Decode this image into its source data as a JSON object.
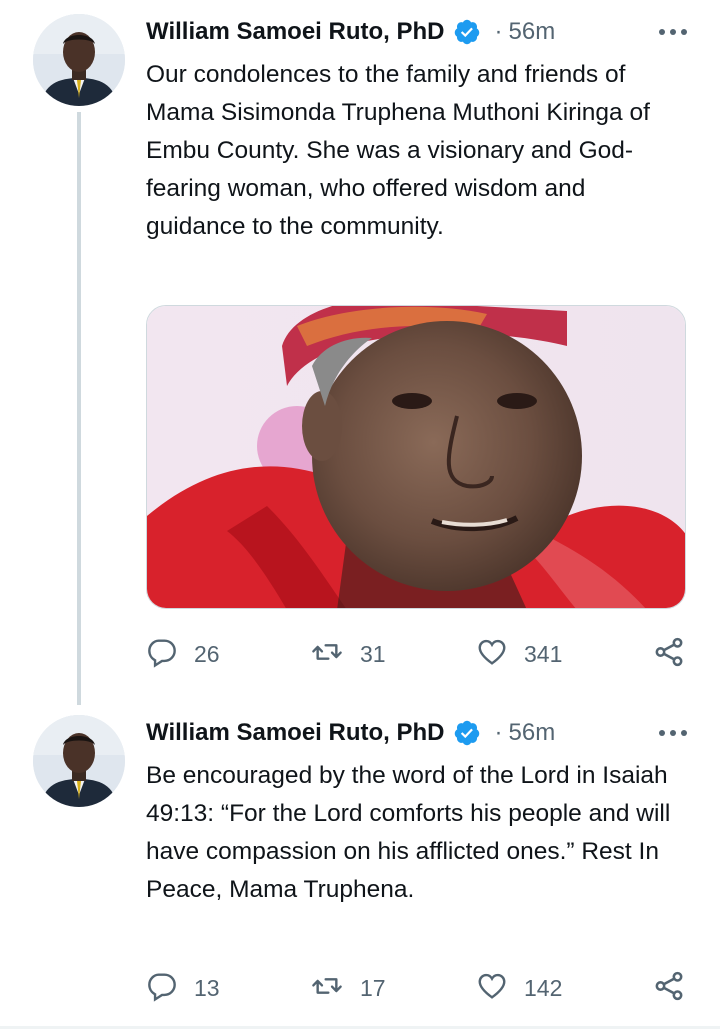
{
  "tweets": [
    {
      "author": {
        "name": "William Samoei Ruto, PhD",
        "verified": true
      },
      "separator": "·",
      "time": "56m",
      "text": "Our condolences to the family and friends of Mama Sisimonda Truphena Muthoni Kiringa of Embu County. She was a visionary and God-fearing woman, who offered wisdom and guidance to the community.",
      "has_media": true,
      "stats": {
        "replies": "26",
        "retweets": "31",
        "likes": "341"
      }
    },
    {
      "author": {
        "name": "William Samoei Ruto, PhD",
        "verified": true
      },
      "separator": "·",
      "time": "56m",
      "text": "Be encouraged by the word of the Lord in Isaiah 49:13: “For the Lord comforts his people and will have compassion on his afflicted ones.” Rest In Peace, Mama Truphena.",
      "has_media": false,
      "stats": {
        "replies": "13",
        "retweets": "17",
        "likes": "142"
      }
    }
  ],
  "icons": {
    "verified": "verified-badge-icon",
    "more": "more-options-icon",
    "reply": "reply-icon",
    "retweet": "retweet-icon",
    "like": "like-icon",
    "share": "share-icon"
  },
  "colors": {
    "text": "#0f1419",
    "secondary": "#536471",
    "verified": "#1d9bf0",
    "thread_line": "#cfd9de"
  }
}
